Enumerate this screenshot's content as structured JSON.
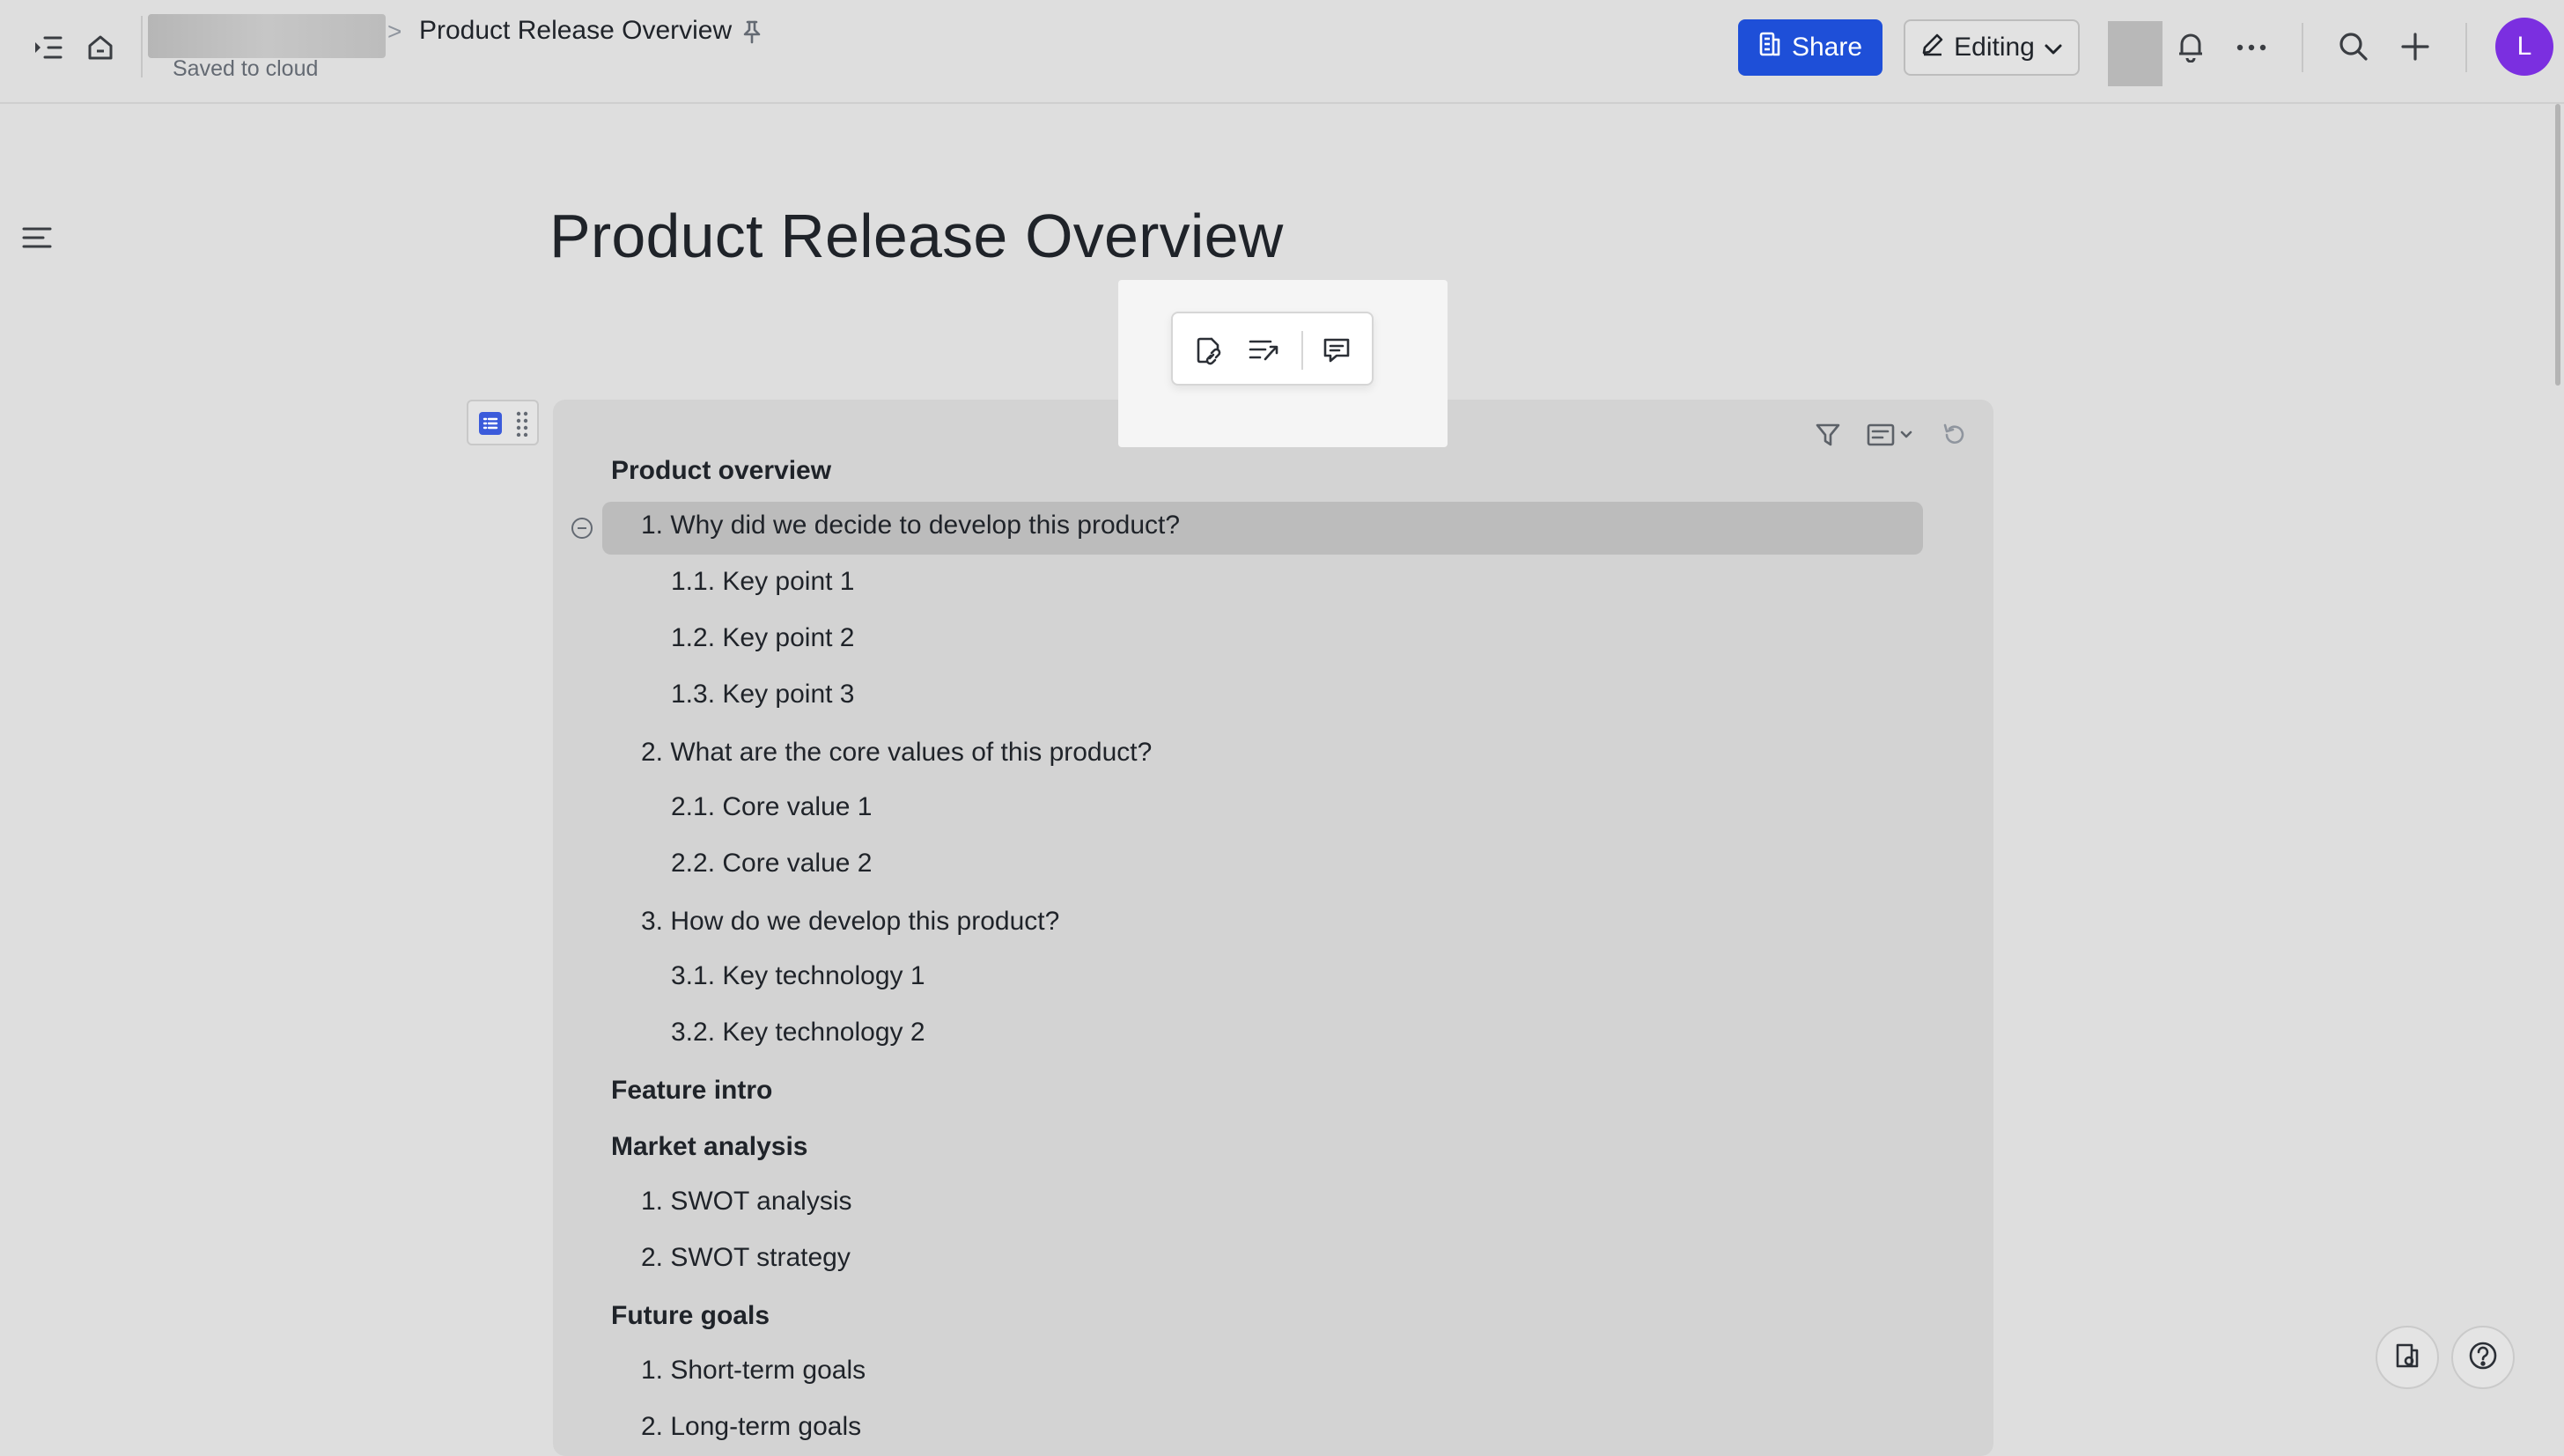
{
  "topbar": {
    "breadcrumb_separator": ">",
    "doc_title": "Product Release Overview",
    "saved_status": "Saved to cloud",
    "share_label": "Share",
    "editing_label": "Editing",
    "user_initial": "L"
  },
  "document": {
    "title": "Product Release Overview"
  },
  "toc": [
    {
      "label": "Product overview",
      "level": 1
    },
    {
      "label": "1. Why did we decide to develop this product?",
      "level": 2,
      "highlighted": true
    },
    {
      "label": "1.1. Key point 1",
      "level": 3
    },
    {
      "label": "1.2. Key point 2",
      "level": 3
    },
    {
      "label": "1.3. Key point 3",
      "level": 3
    },
    {
      "label": "2. What are the core values of this product?",
      "level": 2
    },
    {
      "label": "2.1. Core value 1",
      "level": 3
    },
    {
      "label": "2.2. Core value 2",
      "level": 3
    },
    {
      "label": "3. How do we develop this product?",
      "level": 2
    },
    {
      "label": "3.1. Key technology 1",
      "level": 3
    },
    {
      "label": "3.2. Key technology 2",
      "level": 3
    },
    {
      "label": "Feature intro",
      "level": 1
    },
    {
      "label": "Market analysis",
      "level": 1
    },
    {
      "label": "1. SWOT analysis",
      "level": 2
    },
    {
      "label": "2. SWOT strategy",
      "level": 2
    },
    {
      "label": "Future goals",
      "level": 1
    },
    {
      "label": "1. Short-term goals",
      "level": 2
    },
    {
      "label": "2. Long-term goals",
      "level": 2
    }
  ],
  "icons": {
    "sidebar_toggle": "sidebar-expand-icon",
    "home": "home-icon",
    "pin": "pin-icon",
    "share": "share-doc-icon",
    "edit": "pencil-icon",
    "notifications": "bell-icon",
    "more": "more-icon",
    "search": "search-icon",
    "add": "plus-icon",
    "outline": "outline-icon",
    "copy_link": "copy-link-icon",
    "convert": "convert-text-icon",
    "comment": "comment-icon",
    "filter": "filter-icon",
    "toc_style": "toc-style-icon",
    "refresh": "refresh-icon",
    "doc_info": "doc-info-icon",
    "help": "help-icon"
  },
  "colors": {
    "accent": "#1e4fd8",
    "avatar": "#7b2fe0",
    "background": "#dedede",
    "toc_card": "#d3d3d3"
  }
}
